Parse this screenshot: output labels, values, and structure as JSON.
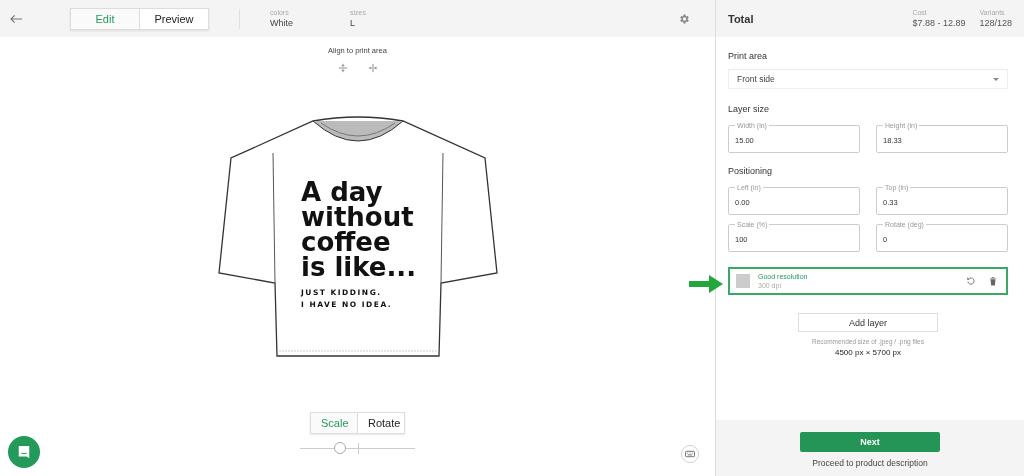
{
  "topbar": {
    "mode_tabs": [
      {
        "label": "Edit",
        "selected": true
      },
      {
        "label": "Preview",
        "selected": false
      }
    ],
    "options": [
      {
        "label": "colors",
        "value": "White"
      },
      {
        "label": "sizes",
        "value": "L"
      }
    ]
  },
  "canvas": {
    "align_label": "Align to print area",
    "design": {
      "headline": [
        "A day",
        "without",
        "coffee",
        "is like..."
      ],
      "tagline": [
        "JUST KIDDING.",
        "I HAVE NO IDEA."
      ]
    },
    "transform_tabs": [
      {
        "label": "Scale",
        "selected": true
      },
      {
        "label": "Rotate",
        "selected": false
      }
    ],
    "slider": {
      "level": 0.35
    }
  },
  "panel": {
    "title": "Total",
    "stats": [
      {
        "label": "Cost",
        "value": "$7.88 - 12.89"
      },
      {
        "label": "Variants",
        "value": "128/128"
      }
    ],
    "print_area": {
      "heading": "Print area",
      "value": "Front side"
    },
    "layer_size": {
      "heading": "Layer size",
      "fields": [
        {
          "label": "Width (in)",
          "value": "15.00"
        },
        {
          "label": "Height (in)",
          "value": "18.33"
        }
      ]
    },
    "positioning": {
      "heading": "Positioning",
      "fields": [
        {
          "label": "Left (in)",
          "value": "0.00"
        },
        {
          "label": "Top (in)",
          "value": "0.33"
        },
        {
          "label": "Scale (%)",
          "value": "100"
        },
        {
          "label": "Rotate (deg)",
          "value": "0"
        }
      ]
    },
    "layer": {
      "title": "Good resolution",
      "subtitle": "300 dpi",
      "selected": true
    },
    "add_layer": "Add layer",
    "recommendation": "Recommended size of .jpeg / .png files",
    "dimensions": "4500 px × 5700 px",
    "next": "Next",
    "proceed": "Proceed to product description"
  }
}
